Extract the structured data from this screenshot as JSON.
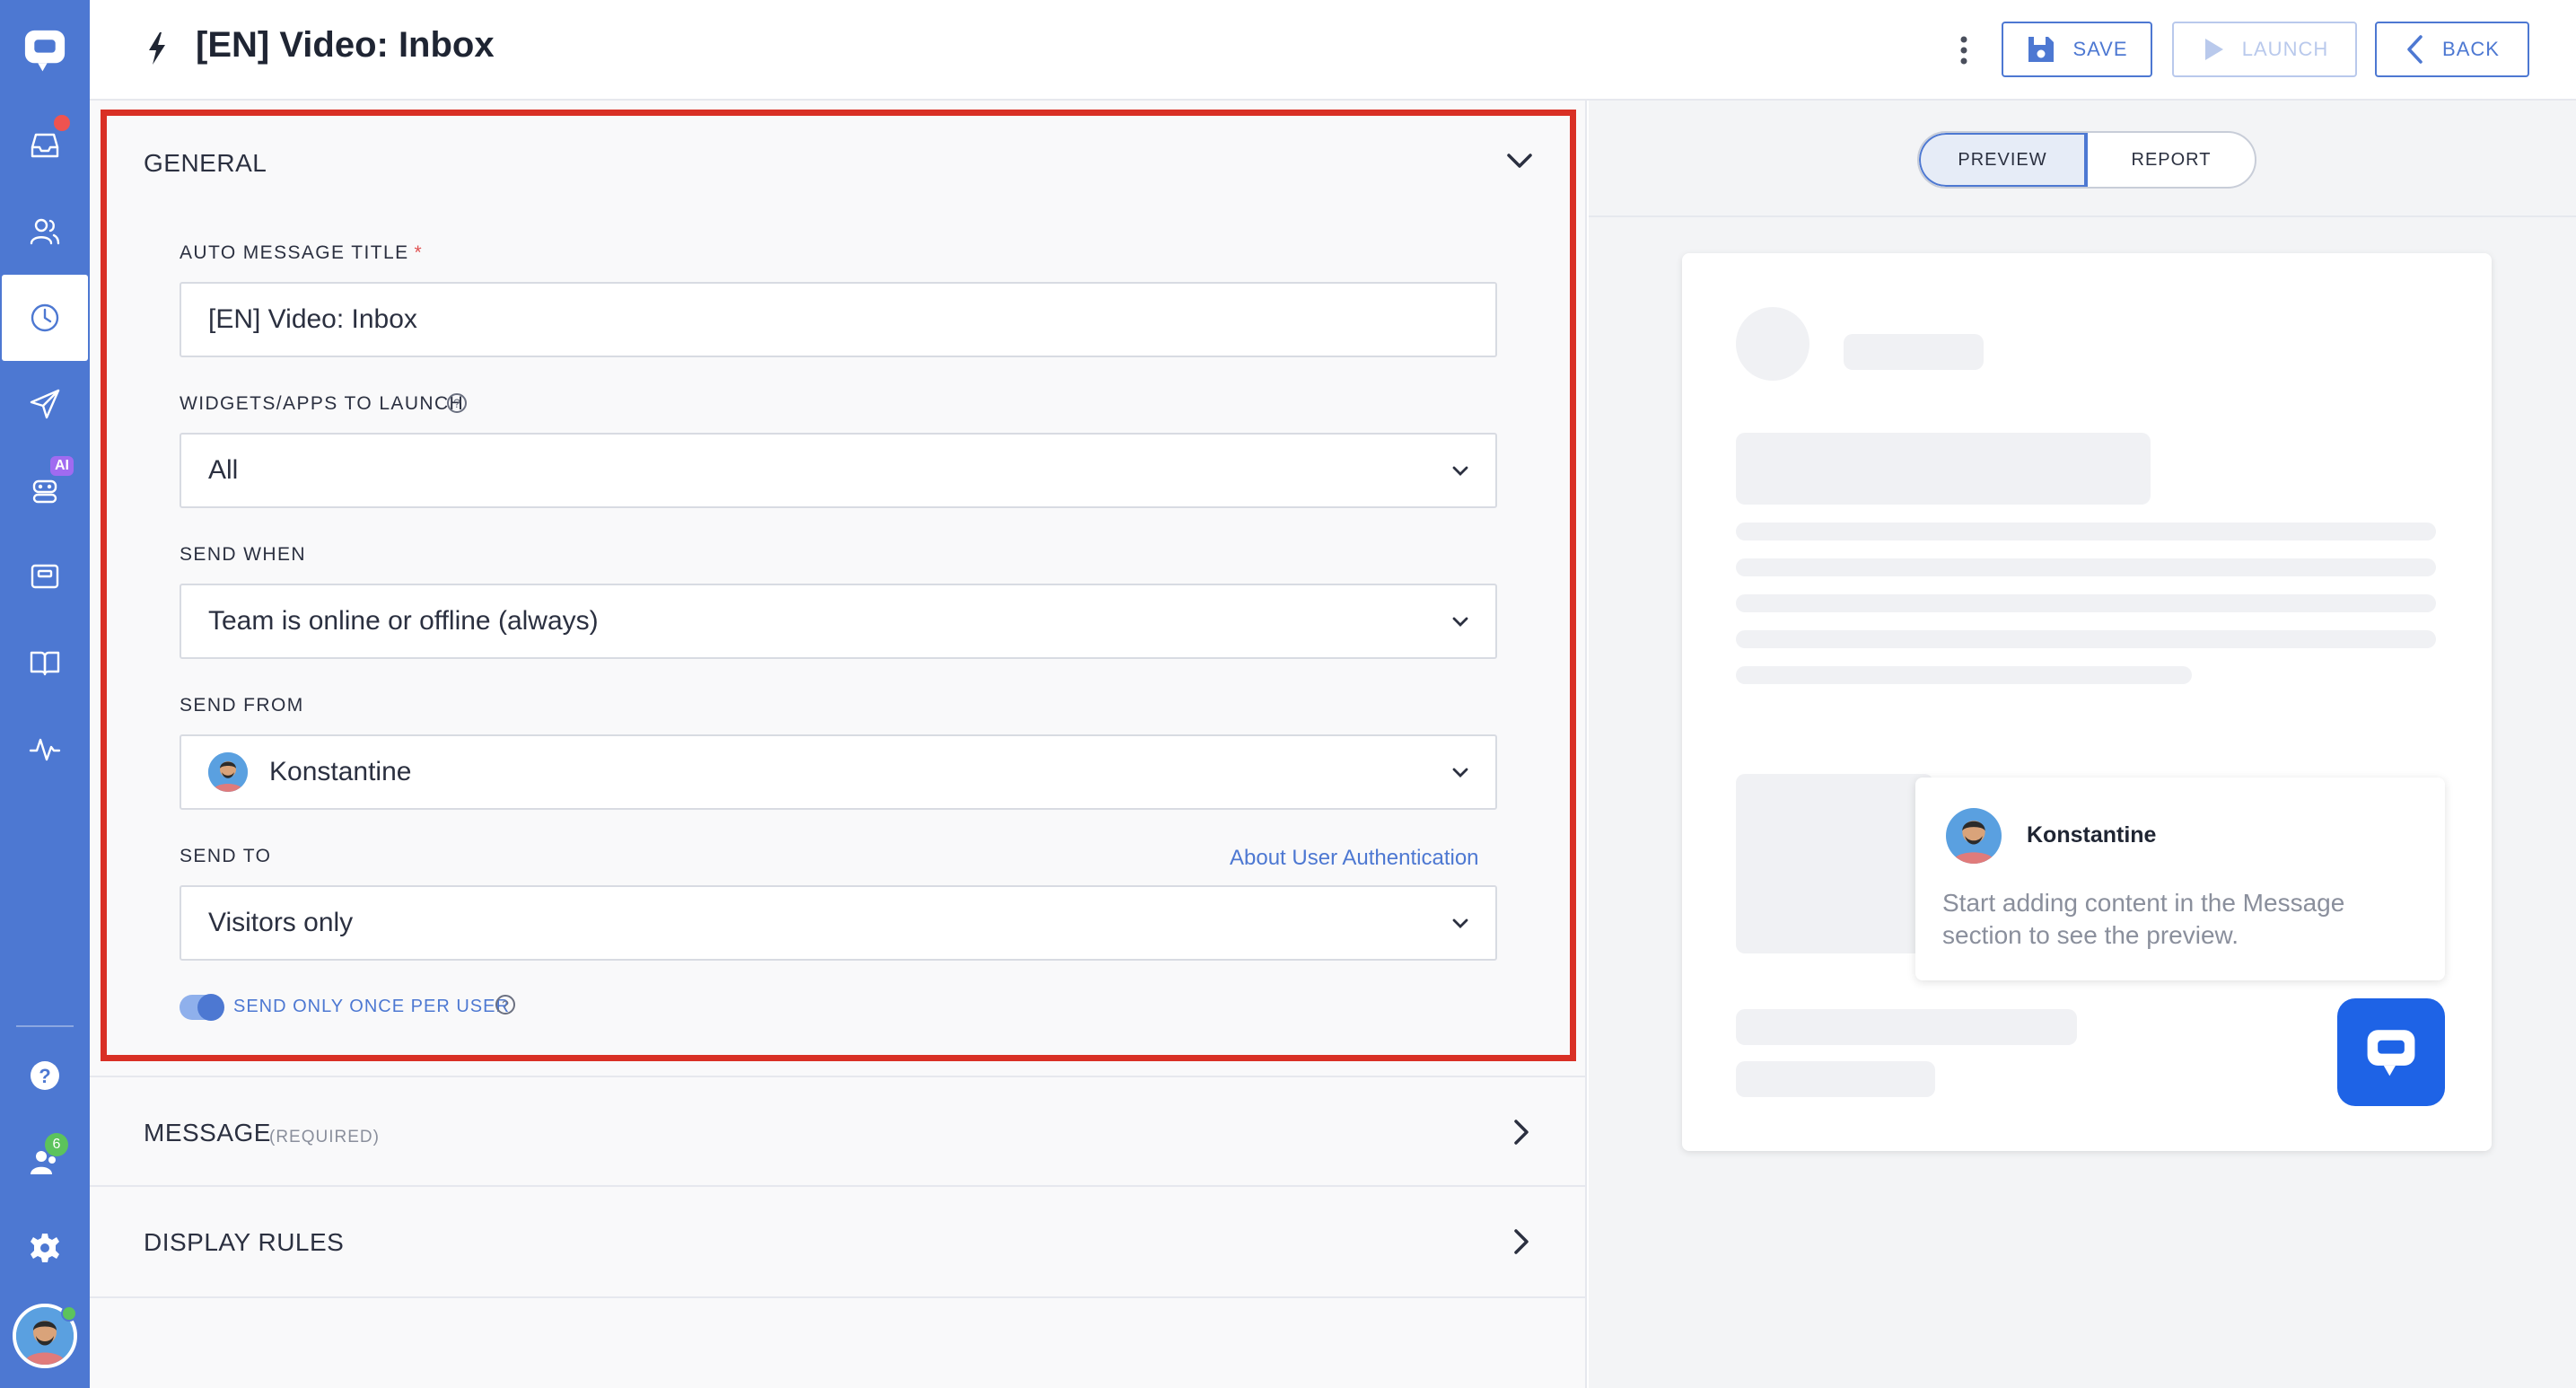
{
  "header": {
    "title": "[EN] Video: Inbox",
    "save_label": "SAVE",
    "launch_label": "LAUNCH",
    "back_label": "BACK"
  },
  "sidebar": {
    "items": [
      {
        "name": "logo",
        "icon": "chat-logo-icon"
      },
      {
        "name": "inbox",
        "icon": "inbox-icon"
      },
      {
        "name": "contacts",
        "icon": "users-icon"
      },
      {
        "name": "auto-messages",
        "icon": "clock-icon"
      },
      {
        "name": "campaigns",
        "icon": "send-icon"
      },
      {
        "name": "chatbots",
        "icon": "bot-icon"
      },
      {
        "name": "widget",
        "icon": "widget-icon"
      },
      {
        "name": "knowledge-base",
        "icon": "book-icon"
      },
      {
        "name": "reports",
        "icon": "activity-icon"
      },
      {
        "name": "help",
        "icon": "help-icon"
      },
      {
        "name": "team",
        "icon": "team-icon"
      },
      {
        "name": "settings",
        "icon": "gear-icon"
      }
    ],
    "ai_badge": "AI",
    "team_count": "6"
  },
  "general": {
    "section_title": "GENERAL",
    "title_label": "AUTO MESSAGE TITLE",
    "title_required": "*",
    "title_value": "[EN] Video: Inbox",
    "widgets_label": "WIDGETS/APPS TO LAUNCH",
    "widgets_value": "All",
    "send_when_label": "SEND WHEN",
    "send_when_value": "Team is online or offline (always)",
    "send_from_label": "SEND FROM",
    "send_from_value": "Konstantine",
    "send_to_label": "SEND TO",
    "auth_link": "About User Authentication",
    "send_to_value": "Visitors only",
    "send_once_label": "SEND ONLY ONCE PER USER",
    "send_once_enabled": true
  },
  "message_section": {
    "title": "MESSAGE",
    "hint": "(REQUIRED)"
  },
  "display_rules_section": {
    "title": "DISPLAY RULES"
  },
  "preview": {
    "tabs": [
      "PREVIEW",
      "REPORT"
    ],
    "active_tab": "PREVIEW",
    "sender_name": "Konstantine",
    "placeholder_text": "Start adding content in the Message section to see the preview."
  },
  "colors": {
    "accent": "#4d78d2",
    "highlight_border": "#d93025",
    "launcher": "#1e63e6"
  }
}
